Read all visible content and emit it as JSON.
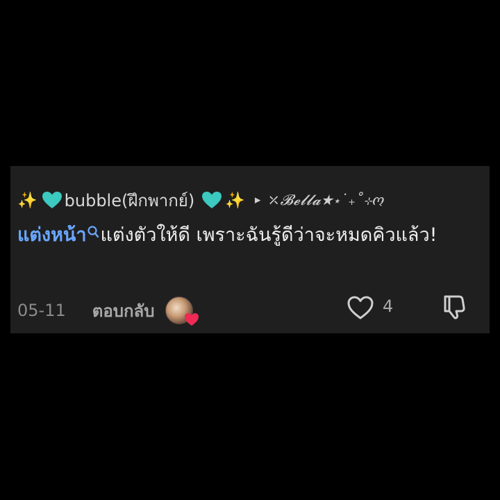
{
  "comment": {
    "author": {
      "prefix_sparkle": "✨",
      "name": "bubble(ฝึกพากย์)",
      "suffix_sparkle": "✨",
      "reply_arrow": "▸",
      "reply_to": "⤫𝓑𝓮𝓵𝓵𝓪★⋆˙₊˚⊹ო"
    },
    "body": {
      "keyword": "แต่งหน้า",
      "text": "แต่งตัวให้ดี เพราะฉันรู้ดีว่าจะหมดคิวแล้ว!"
    },
    "meta": {
      "date": "05-11",
      "reply_label": "ตอบกลับ",
      "like_count": "4"
    }
  },
  "colors": {
    "background": "#000000",
    "card": "#1f1f1f",
    "keyword": "#6aa7ff",
    "heart_teal": "#3cc9c0",
    "sparkle": "#f3c74a",
    "muted": "#8b8b8b"
  },
  "icons": [
    "sparkles-icon",
    "teal-heart-icon",
    "reply-arrow-icon",
    "search-icon",
    "avatar",
    "like-heart-icon",
    "dislike-icon"
  ]
}
